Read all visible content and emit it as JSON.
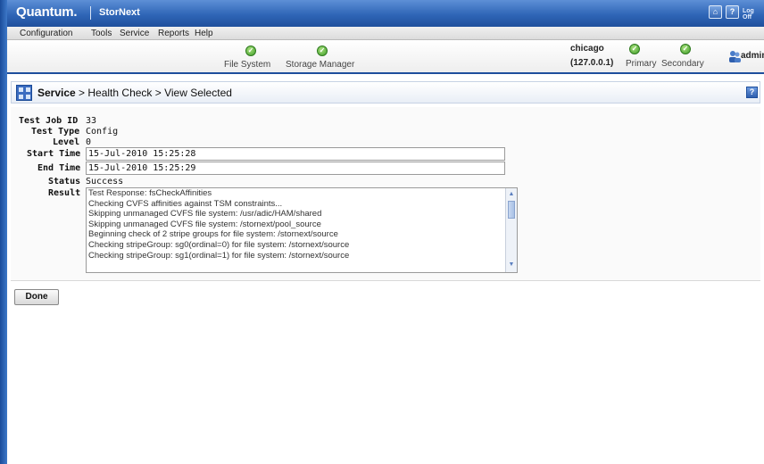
{
  "brand": {
    "name": "Quantum.",
    "product": "StorNext",
    "logoff_label": "Log Off"
  },
  "menu": {
    "items": [
      "Configuration",
      "Tools",
      "Service",
      "Reports",
      "Help"
    ]
  },
  "status": {
    "file_system_label": "File System",
    "storage_manager_label": "Storage Manager",
    "host_name": "chicago",
    "host_ip": "(127.0.0.1)",
    "primary_label": "Primary",
    "secondary_label": "Secondary",
    "user_label": "admin",
    "ok_color": "#3f9e2a"
  },
  "page": {
    "section": "Service",
    "path": " > Health Check > View Selected"
  },
  "details": {
    "test_job_id_label": "Test Job ID",
    "test_job_id": "33",
    "test_type_label": "Test Type",
    "test_type": "Config",
    "level_label": "Level",
    "level": "0",
    "start_time_label": "Start Time",
    "start_time": "15-Jul-2010 15:25:28",
    "end_time_label": "End Time",
    "end_time": "15-Jul-2010 15:25:29",
    "status_label": "Status",
    "status": "Success",
    "result_label": "Result",
    "result_lines": [
      "Test Response: fsCheckAffinities",
      "Checking CVFS affinities against TSM constraints...",
      "Skipping unmanaged CVFS file system: /usr/adic/HAM/shared",
      "Skipping unmanaged CVFS file system: /stornext/pool_source",
      "Beginning check of 2 stripe groups for file system: /stornext/source",
      "Checking stripeGroup: sg0(ordinal=0) for file system: /stornext/source",
      "Checking stripeGroup: sg1(ordinal=1) for file system: /stornext/source"
    ]
  },
  "actions": {
    "done_label": "Done"
  }
}
